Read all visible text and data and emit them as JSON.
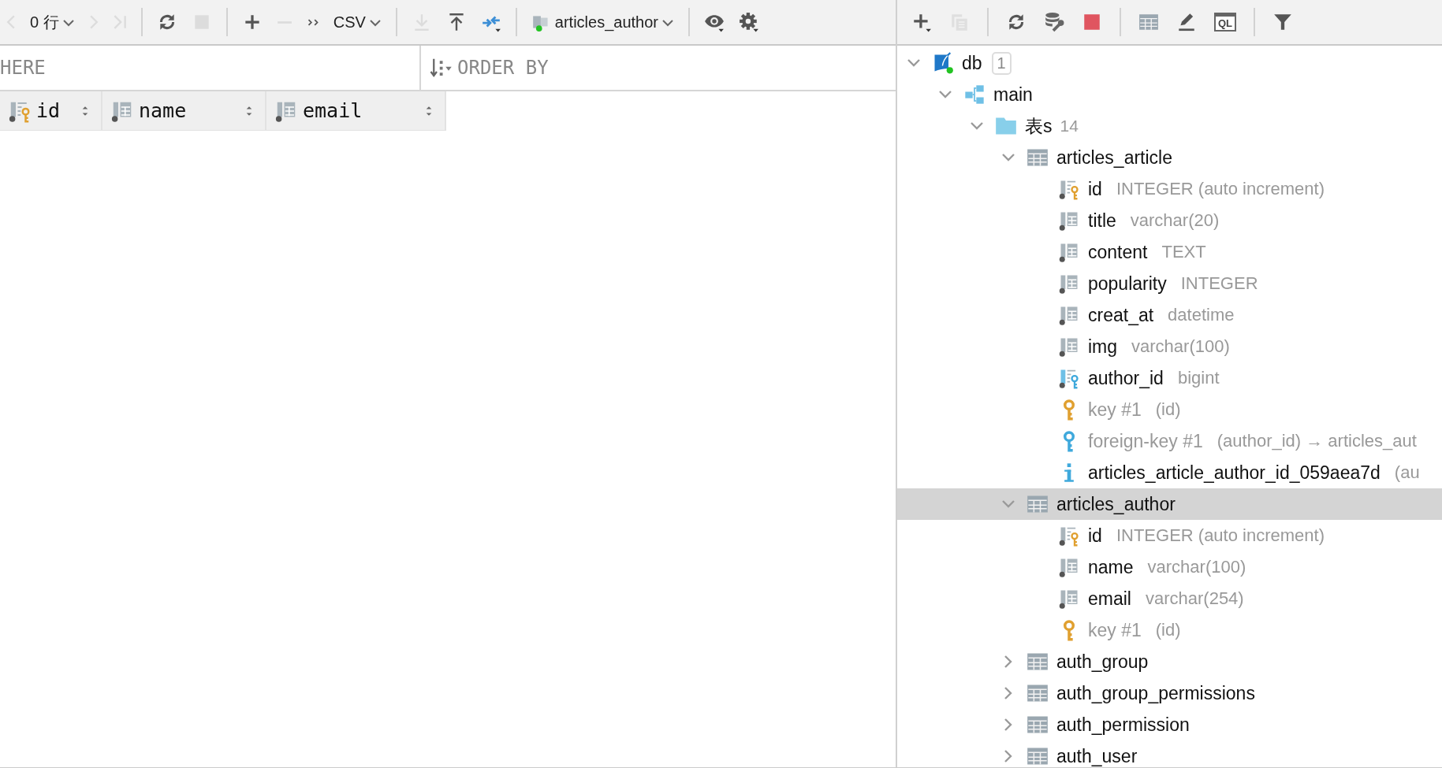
{
  "editor": {
    "toolbar": [
      [
        {
          "kind": "prev",
          "disabled": true
        },
        {
          "kind": "rows",
          "label": "0 行",
          "disabled": false
        },
        {
          "kind": "next",
          "disabled": true
        },
        {
          "kind": "last",
          "disabled": true
        }
      ],
      [
        {
          "kind": "reload",
          "disabled": false
        },
        {
          "kind": "stop",
          "disabled": true
        }
      ],
      [
        {
          "kind": "add",
          "disabled": false
        },
        {
          "kind": "remove",
          "disabled": true
        },
        {
          "kind": "more",
          "disabled": false
        },
        {
          "kind": "format",
          "label": "CSV",
          "disabled": false
        }
      ],
      [
        {
          "kind": "export",
          "disabled": true
        },
        {
          "kind": "import",
          "disabled": false
        },
        {
          "kind": "compare",
          "disabled": false
        }
      ],
      [
        {
          "kind": "session",
          "label": "articles_author",
          "disabled": false
        }
      ],
      [
        {
          "kind": "view",
          "disabled": false
        },
        {
          "kind": "settings",
          "disabled": false
        }
      ]
    ],
    "where": {
      "placeholder": "HERE"
    },
    "order_by": {
      "placeholder": "ORDER BY"
    },
    "columns": [
      {
        "label": "id",
        "kind": "keycolumn"
      },
      {
        "label": "name",
        "kind": "column"
      },
      {
        "label": "email",
        "kind": "column"
      }
    ]
  },
  "explorer": {
    "toolbar": [
      [
        {
          "kind": "add_menu",
          "disabled": false
        },
        {
          "kind": "duplicate",
          "disabled": true
        }
      ],
      [
        {
          "kind": "reload",
          "disabled": false
        },
        {
          "kind": "db_tools",
          "disabled": false
        },
        {
          "kind": "stop_red",
          "disabled": false
        }
      ],
      [
        {
          "kind": "table",
          "disabled": false
        },
        {
          "kind": "edit",
          "disabled": false
        },
        {
          "kind": "console",
          "label": "QL",
          "disabled": false
        }
      ],
      [
        {
          "kind": "filter",
          "disabled": false
        }
      ]
    ],
    "tree": [
      {
        "kind": "database",
        "label": "db",
        "badge": "1",
        "expanded": true,
        "selected": false,
        "children": [
          {
            "kind": "schema",
            "label": "main",
            "expanded": true,
            "selected": false,
            "children": [
              {
                "kind": "folder",
                "label": "表s",
                "count": "14",
                "expanded": true,
                "selected": false,
                "children": [
                  {
                    "kind": "table",
                    "label": "articles_article",
                    "expanded": true,
                    "selected": false,
                    "children": [
                      {
                        "kind": "keycolumn",
                        "label": "id",
                        "detail": "INTEGER (auto increment)",
                        "selected": false
                      },
                      {
                        "kind": "column",
                        "label": "title",
                        "detail": "varchar(20)",
                        "selected": false
                      },
                      {
                        "kind": "column",
                        "label": "content",
                        "detail": "TEXT",
                        "selected": false
                      },
                      {
                        "kind": "column",
                        "label": "popularity",
                        "detail": "INTEGER",
                        "selected": false
                      },
                      {
                        "kind": "column",
                        "label": "creat_at",
                        "detail": "datetime",
                        "selected": false
                      },
                      {
                        "kind": "column",
                        "label": "img",
                        "detail": "varchar(100)",
                        "selected": false
                      },
                      {
                        "kind": "fkcolumn",
                        "label": "author_id",
                        "detail": "bigint",
                        "selected": false
                      },
                      {
                        "kind": "key",
                        "label": "key #1",
                        "detail": "(id)",
                        "selected": false
                      },
                      {
                        "kind": "foreign_key",
                        "label": "foreign-key #1",
                        "detail": "(author_id) → articles_aut",
                        "selected": false
                      },
                      {
                        "kind": "index",
                        "label": "articles_article_author_id_059aea7d",
                        "detail": "(au",
                        "selected": false
                      }
                    ]
                  },
                  {
                    "kind": "table",
                    "label": "articles_author",
                    "expanded": true,
                    "selected": true,
                    "children": [
                      {
                        "kind": "keycolumn",
                        "label": "id",
                        "detail": "INTEGER (auto increment)",
                        "selected": false
                      },
                      {
                        "kind": "column",
                        "label": "name",
                        "detail": "varchar(100)",
                        "selected": false
                      },
                      {
                        "kind": "column",
                        "label": "email",
                        "detail": "varchar(254)",
                        "selected": false
                      },
                      {
                        "kind": "key",
                        "label": "key #1",
                        "detail": "(id)",
                        "selected": false
                      }
                    ]
                  },
                  {
                    "kind": "table",
                    "label": "auth_group",
                    "expanded": false,
                    "selected": false
                  },
                  {
                    "kind": "table",
                    "label": "auth_group_permissions",
                    "expanded": false,
                    "selected": false
                  },
                  {
                    "kind": "table",
                    "label": "auth_permission",
                    "expanded": false,
                    "selected": false
                  },
                  {
                    "kind": "table",
                    "label": "auth_user",
                    "expanded": false,
                    "selected": false
                  }
                ]
              }
            ]
          }
        ]
      }
    ]
  }
}
